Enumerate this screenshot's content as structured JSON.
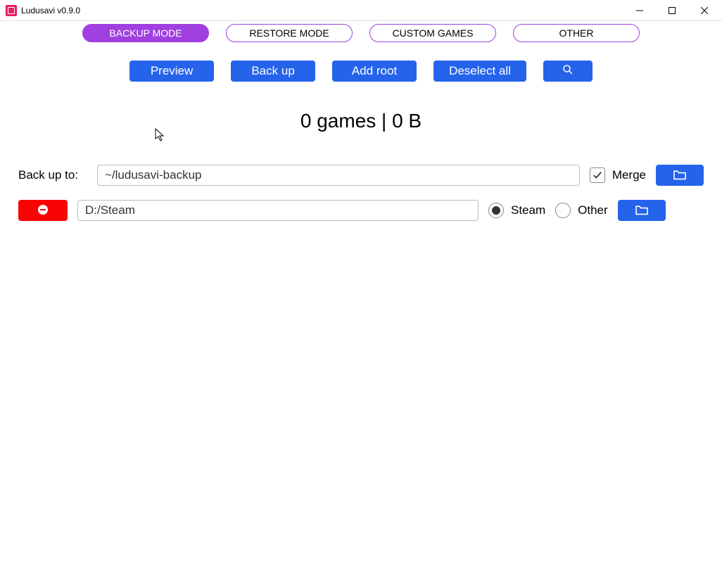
{
  "window": {
    "title": "Ludusavi v0.9.0"
  },
  "tabs": {
    "backup": "BACKUP MODE",
    "restore": "RESTORE MODE",
    "custom": "CUSTOM GAMES",
    "other": "OTHER"
  },
  "actions": {
    "preview": "Preview",
    "backup": "Back up",
    "add_root": "Add root",
    "deselect_all": "Deselect all"
  },
  "status": "0 games  |  0 B",
  "backup_to": {
    "label": "Back up to:",
    "value": "~/ludusavi-backup",
    "merge_label": "Merge",
    "merge_checked": true
  },
  "roots": [
    {
      "path": "D:/Steam",
      "type": "steam",
      "type_labels": {
        "steam": "Steam",
        "other": "Other"
      }
    }
  ]
}
